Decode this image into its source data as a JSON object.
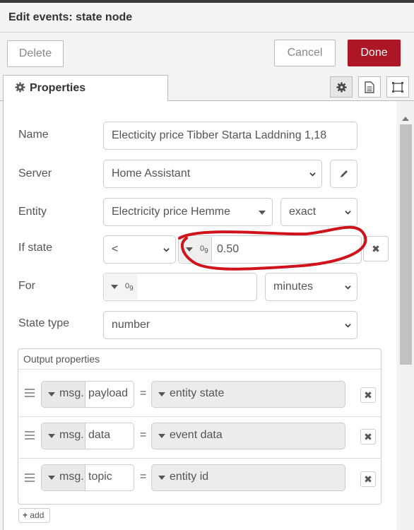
{
  "dialog": {
    "title": "Edit events: state node"
  },
  "toolbar": {
    "delete_label": "Delete",
    "cancel_label": "Cancel",
    "done_label": "Done"
  },
  "tabs": {
    "properties_label": "Properties",
    "icons": [
      "gear-icon",
      "description-icon",
      "appearance-icon"
    ]
  },
  "form": {
    "name": {
      "label": "Name",
      "value": "Electicity price Tibber Starta Laddning 1,18"
    },
    "server": {
      "label": "Server",
      "value": "Home Assistant"
    },
    "entity": {
      "label": "Entity",
      "value": "Electricity price Hemme",
      "match": "exact"
    },
    "if_state": {
      "label": "If state",
      "operator": "<",
      "type_glyph": "0 9",
      "value": "0.50"
    },
    "for": {
      "label": "For",
      "type_glyph": "0 9",
      "value": "",
      "unit": "minutes"
    },
    "state_type": {
      "label": "State type",
      "value": "number"
    }
  },
  "output_properties": {
    "title": "Output properties",
    "rows": [
      {
        "prefix": "msg.",
        "property": "payload",
        "equals": "=",
        "value": "entity state"
      },
      {
        "prefix": "msg.",
        "property": "data",
        "equals": "=",
        "value": "event data"
      },
      {
        "prefix": "msg.",
        "property": "topic",
        "equals": "=",
        "value": "entity id"
      }
    ],
    "add_label": "add"
  },
  "colors": {
    "done": "#ad1625",
    "annotation": "#d0131b"
  }
}
